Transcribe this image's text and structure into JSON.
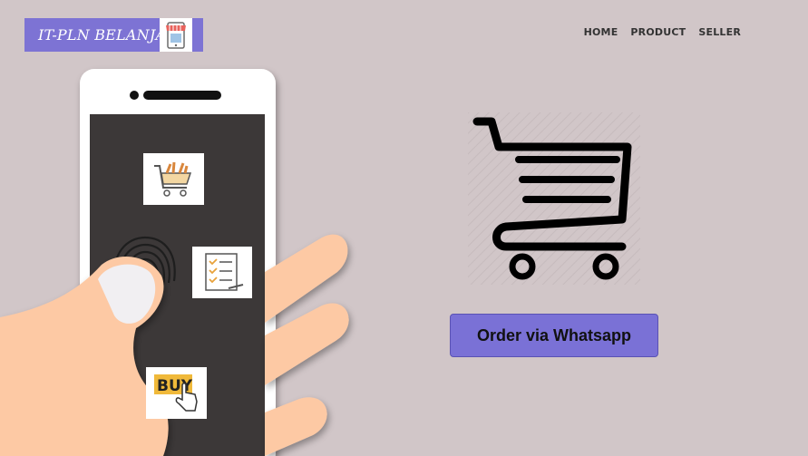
{
  "brand": {
    "name": "IT-PLN BELANJA",
    "logo_icon": "phone-store-icon"
  },
  "nav": {
    "items": [
      {
        "label": "HOME"
      },
      {
        "label": "PRODUCT"
      },
      {
        "label": "SELLER"
      }
    ]
  },
  "hero": {
    "phone_icons": [
      "grocery-cart-icon",
      "checklist-icon",
      "buy-hand-icon"
    ],
    "buy_icon_text": "BUY",
    "cart_icon": "shopping-cart-icon",
    "cta_label": "Order via Whatsapp"
  },
  "colors": {
    "background": "#d1c6c8",
    "brand": "#7d73d4",
    "button": "#7a71d6",
    "phone_screen": "#3c3838",
    "skin": "#fdc9a4"
  }
}
